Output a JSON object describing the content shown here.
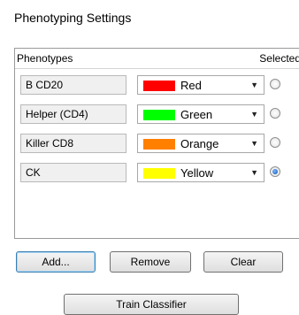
{
  "window": {
    "title": "Phenotyping Settings"
  },
  "table": {
    "headers": {
      "phenotypes": "Phenotypes",
      "selected": "Selected"
    },
    "rows": [
      {
        "name": "B CD20",
        "color": "Red",
        "swatch": "#ff0000",
        "selected": false
      },
      {
        "name": "Helper (CD4)",
        "color": "Green",
        "swatch": "#00ff00",
        "selected": false
      },
      {
        "name": "Killer CD8",
        "color": "Orange",
        "swatch": "#ff8000",
        "selected": false
      },
      {
        "name": "CK",
        "color": "Yellow",
        "swatch": "#ffff00",
        "selected": true
      }
    ]
  },
  "buttons": {
    "add": "Add...",
    "remove": "Remove",
    "clear": "Clear",
    "train": "Train Classifier"
  }
}
